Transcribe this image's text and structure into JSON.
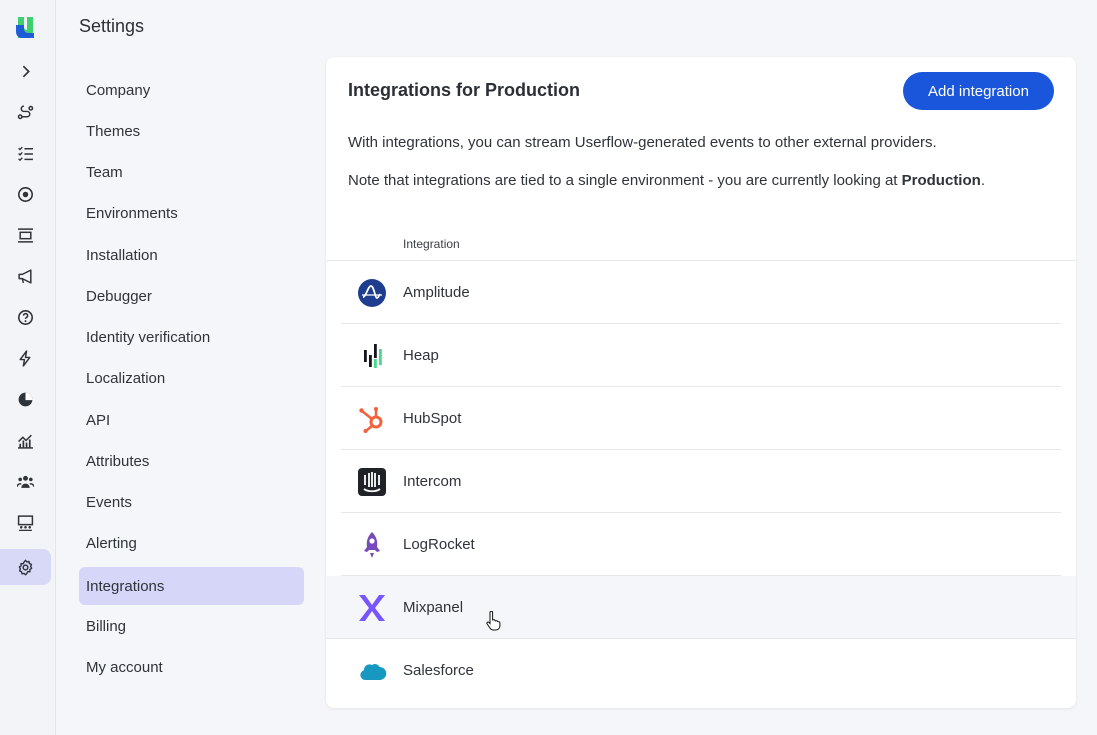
{
  "app": {
    "logo": "userflow-logo"
  },
  "rail": {
    "items": [
      {
        "icon": "chevron-right-icon"
      },
      {
        "icon": "flows-icon"
      },
      {
        "icon": "checklists-icon"
      },
      {
        "icon": "launchers-icon"
      },
      {
        "icon": "banners-icon"
      },
      {
        "icon": "announcements-icon"
      },
      {
        "icon": "resource-center-icon"
      },
      {
        "icon": "actions-icon"
      },
      {
        "icon": "reports-icon"
      },
      {
        "icon": "analytics-icon"
      },
      {
        "icon": "users-icon"
      },
      {
        "icon": "companies-icon"
      },
      {
        "icon": "settings-icon"
      }
    ]
  },
  "page": {
    "title": "Settings"
  },
  "nav": {
    "items": [
      {
        "label": "Company"
      },
      {
        "label": "Themes"
      },
      {
        "label": "Team"
      },
      {
        "label": "Environments"
      },
      {
        "label": "Installation"
      },
      {
        "label": "Debugger"
      },
      {
        "label": "Identity verification"
      },
      {
        "label": "Localization"
      },
      {
        "label": "API"
      },
      {
        "label": "Attributes"
      },
      {
        "label": "Events"
      },
      {
        "label": "Alerting"
      },
      {
        "label": "Integrations",
        "active": true
      },
      {
        "label": "Billing"
      },
      {
        "label": "My account"
      }
    ]
  },
  "main": {
    "title": "Integrations for Production",
    "add_button": "Add integration",
    "description": "With integrations, you can stream Userflow-generated events to other external providers.",
    "note_prefix": "Note that integrations are tied to a single environment - you are currently looking at ",
    "note_env": "Production",
    "note_suffix": ".",
    "column_header": "Integration",
    "integrations": [
      {
        "name": "Amplitude",
        "icon": "amplitude-logo",
        "color": "#1e3d8f"
      },
      {
        "name": "Heap",
        "icon": "heap-logo",
        "color": "#16161d"
      },
      {
        "name": "HubSpot",
        "icon": "hubspot-logo",
        "color": "#f2603c"
      },
      {
        "name": "Intercom",
        "icon": "intercom-logo",
        "color": "#1f2328"
      },
      {
        "name": "LogRocket",
        "icon": "logrocket-logo",
        "color": "#764abc"
      },
      {
        "name": "Mixpanel",
        "icon": "mixpanel-logo",
        "color": "#7856ff"
      },
      {
        "name": "Salesforce",
        "icon": "salesforce-logo",
        "color": "#1798c1"
      }
    ]
  },
  "colors": {
    "accent": "#1a56db",
    "active_nav": "#d6d6f8",
    "rail_active": "#d8d9f7"
  }
}
